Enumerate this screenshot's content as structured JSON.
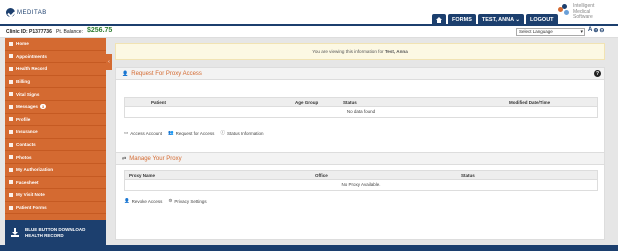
{
  "header": {
    "logo_text": "MEDITAB",
    "nav": {
      "forms": "FORMS",
      "user": "TEST, ANNA ⌄",
      "logout": "LOGOUT"
    },
    "ims_lines": [
      "Intelligent",
      "Medical",
      "Software"
    ]
  },
  "infobar": {
    "clinic_id": "Clinic ID: P1377736",
    "balance_label": "Pt. Balance:",
    "balance_value": "$256.75",
    "language_select": "Select Language",
    "tools": [
      "A",
      "⊕",
      "⊖"
    ]
  },
  "sidebar": {
    "items": [
      {
        "label": "Home"
      },
      {
        "label": "Appointments"
      },
      {
        "label": "Health Record"
      },
      {
        "label": "Billing"
      },
      {
        "label": "Vital Signs"
      },
      {
        "label": "Messages",
        "badge": "3"
      },
      {
        "label": "Profile"
      },
      {
        "label": "Insurance"
      },
      {
        "label": "Contacts"
      },
      {
        "label": "Photos"
      },
      {
        "label": "My Authorization"
      },
      {
        "label": "Facesheet"
      },
      {
        "label": "My Visit Note"
      },
      {
        "label": "Patient Forms"
      }
    ],
    "download_line1": "BLUE BUTTON DOWNLOAD",
    "download_line2": "HEALTH RECORD"
  },
  "main": {
    "notice_prefix": "You are viewing this information for ",
    "notice_name": "Test, Anna",
    "proxy_access": {
      "title": "Request For Proxy Access",
      "columns": [
        "Patient",
        "Age Group",
        "Status",
        "Modified Date/Time"
      ],
      "empty": "No data found",
      "links": [
        "Access Account",
        "Request for Access",
        "Status Information"
      ]
    },
    "manage_proxy": {
      "title": "Manage Your Proxy",
      "columns": [
        "Proxy Name",
        "Office",
        "Status"
      ],
      "empty": "No Proxy Available.",
      "links": [
        "Revoke Access",
        "Privacy Settings"
      ]
    }
  },
  "colors": {
    "navy": "#1c3f6e",
    "orange": "#d46a31",
    "balance_green": "#2f7d32"
  }
}
